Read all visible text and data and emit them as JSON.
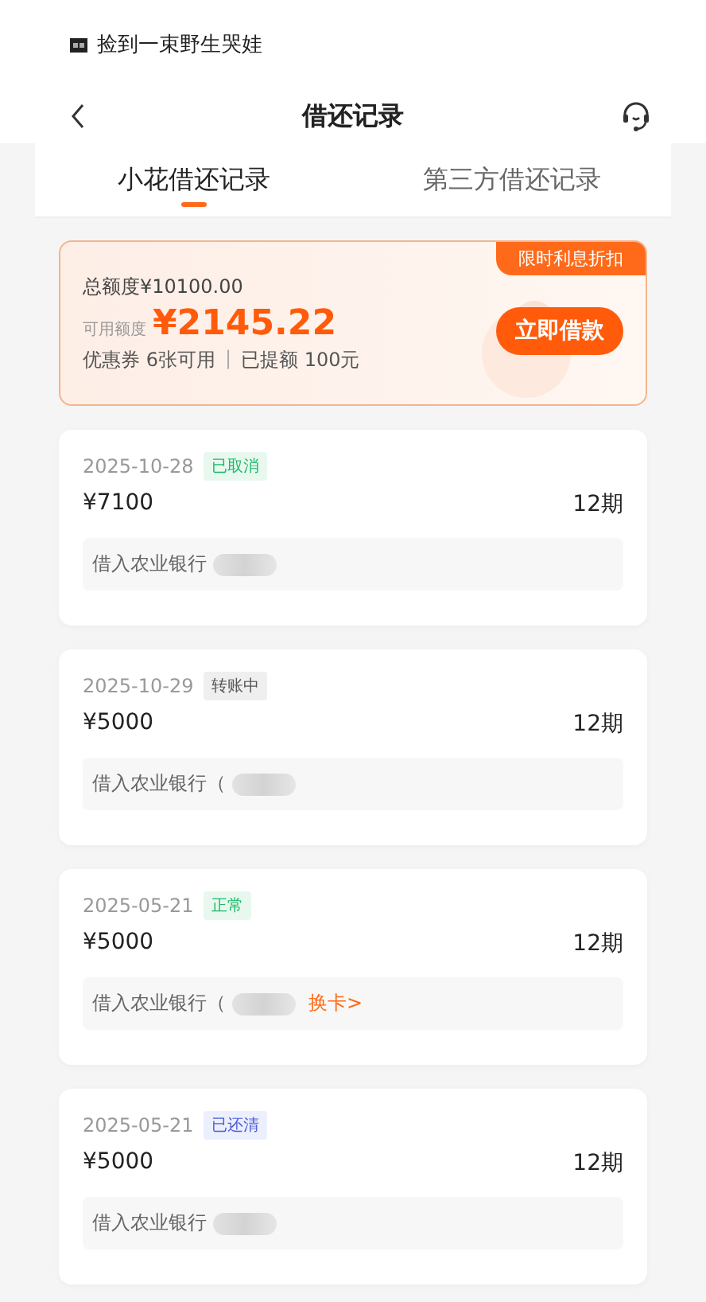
{
  "status_bar": {
    "notification": "捡到一束野生哭娃"
  },
  "nav": {
    "title": "借还记录"
  },
  "tabs": [
    {
      "label": "小花借还记录",
      "selected": true
    },
    {
      "label": "第三方借还记录",
      "selected": false
    }
  ],
  "credit": {
    "total": "总额度¥10100.00",
    "available_label": "可用额度",
    "available": "¥2145.22",
    "ribbon": "限时利息折扣",
    "button": "立即借款",
    "coupon": "优惠券 6张可用",
    "separator": "|",
    "raised": "已提额 100元"
  },
  "records": [
    {
      "date": "2025-10-28",
      "status": {
        "label": "已取消",
        "kind": "cancelled"
      },
      "amount": "¥7100",
      "term": "12期",
      "account": "借入农业银行",
      "redacted": true
    },
    {
      "date": "2025-10-29",
      "status": {
        "label": "转账中",
        "kind": "pending"
      },
      "amount": "¥5000",
      "term": "12期",
      "account": "借入农业银行（",
      "redacted": true
    },
    {
      "date": "2025-05-21",
      "status": {
        "label": "正常",
        "kind": "normal"
      },
      "amount": "¥5000",
      "term": "12期",
      "account": "借入农业银行（",
      "redacted": true,
      "link": "换卡>"
    },
    {
      "date": "2025-05-21",
      "status": {
        "label": "已还清",
        "kind": "settled"
      },
      "amount": "¥5000",
      "term": "12期",
      "account": "借入农业银行",
      "redacted": true
    }
  ]
}
